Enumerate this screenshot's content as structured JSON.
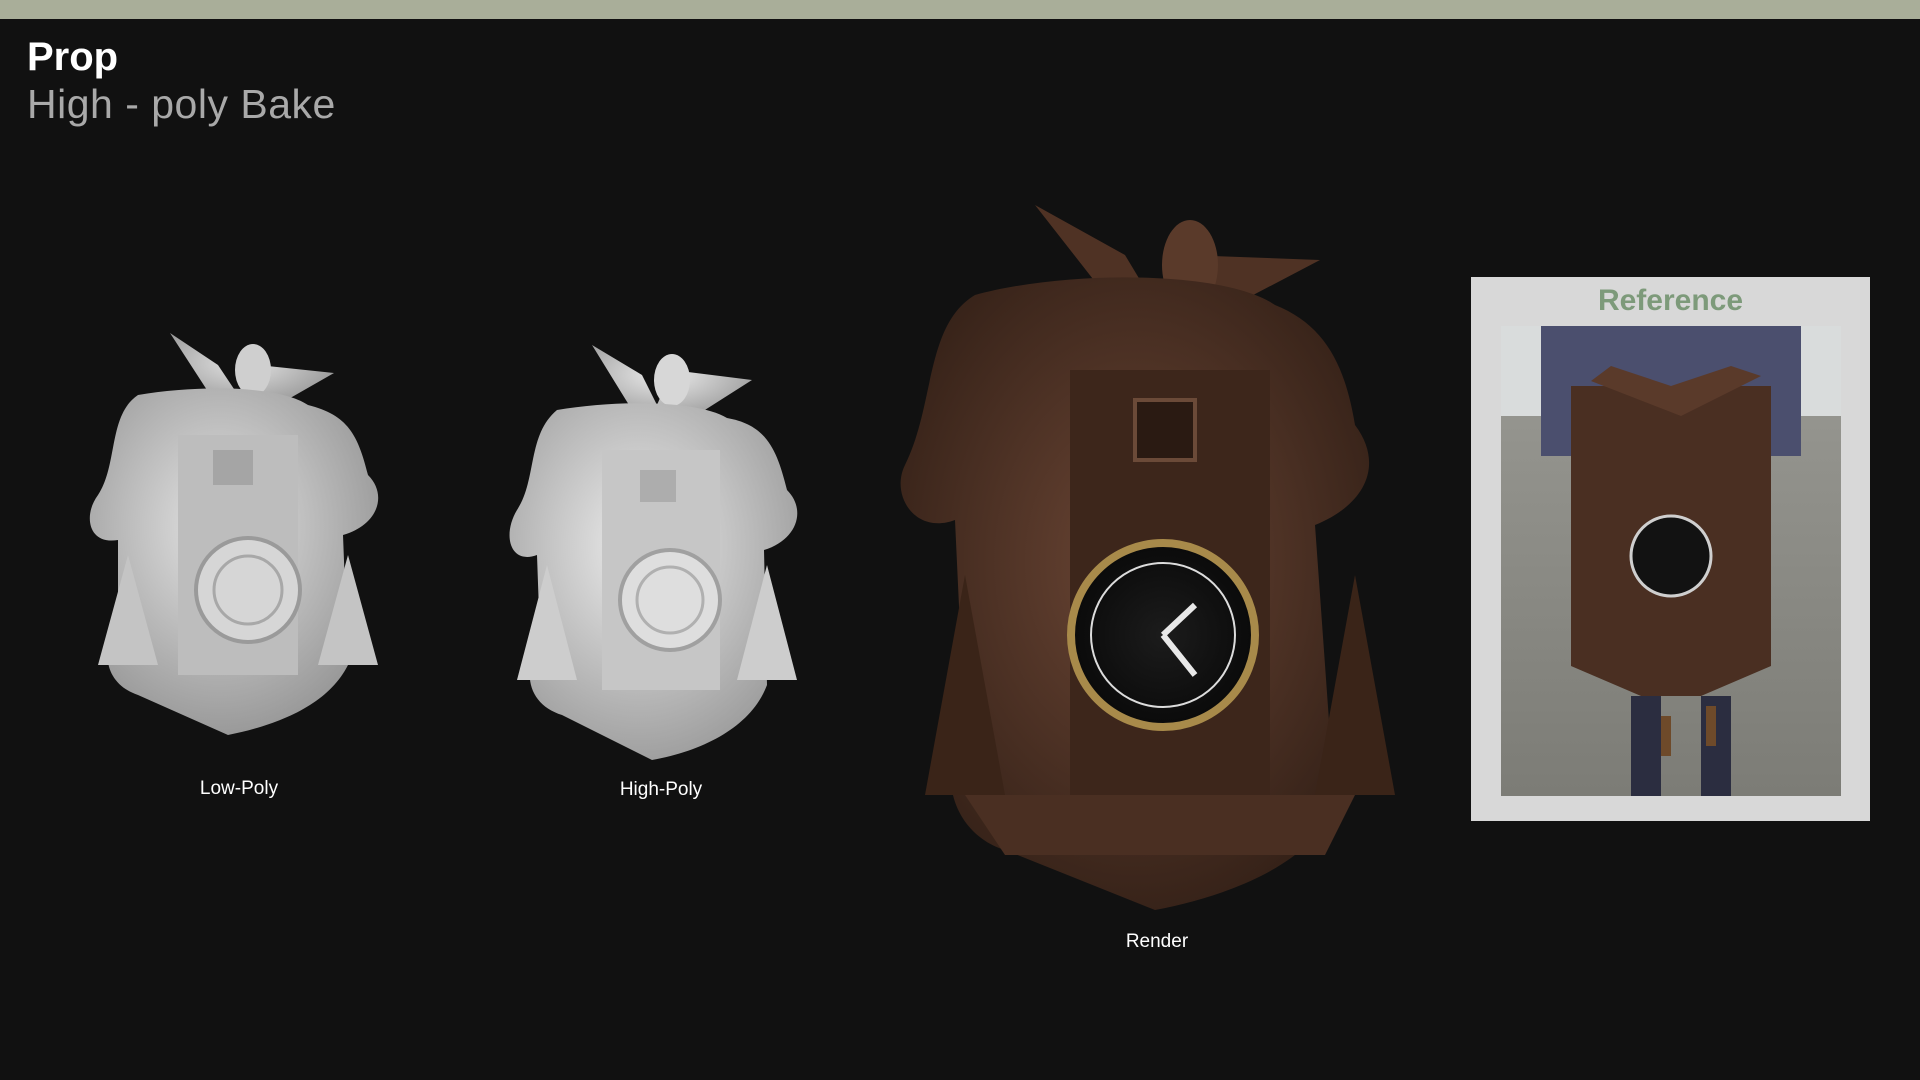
{
  "header": {
    "title": "Prop",
    "subtitle": "High - poly Bake"
  },
  "figures": [
    {
      "caption": "Low-Poly",
      "icon": "low-poly-clock-model"
    },
    {
      "caption": "High-Poly",
      "icon": "high-poly-clock-model"
    },
    {
      "caption": "Render",
      "icon": "rendered-clock-model"
    }
  ],
  "reference": {
    "title": "Reference",
    "icon": "reference-photo"
  },
  "colors": {
    "background": "#111111",
    "top_bar": "#a9ae99",
    "clay": "#c9c9c9",
    "wood": "#4a2f22",
    "reference_title": "#7d9a7a",
    "reference_card": "#d8d8d8"
  }
}
